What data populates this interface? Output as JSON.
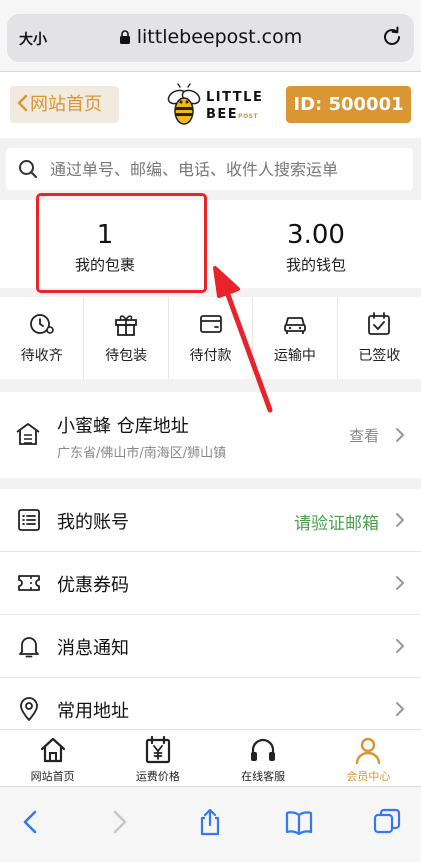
{
  "browser": {
    "text_size_label": "大小",
    "url": "littlebeepost.com"
  },
  "header": {
    "back_label": "网站首页",
    "logo_line1": "LITTLE",
    "logo_line2": "BEE",
    "logo_post": "POST",
    "id_label": "ID: 500001"
  },
  "search": {
    "placeholder": "通过单号、邮编、电话、收件人搜索运单"
  },
  "stats": [
    {
      "value": "1",
      "label": "我的包裹"
    },
    {
      "value": "3.00",
      "label": "我的钱包"
    }
  ],
  "status_items": [
    {
      "label": "待收齐",
      "icon": "clock-gear-icon"
    },
    {
      "label": "待包装",
      "icon": "gift-icon"
    },
    {
      "label": "待付款",
      "icon": "wallet-card-icon"
    },
    {
      "label": "运输中",
      "icon": "car-icon"
    },
    {
      "label": "已签收",
      "icon": "calendar-check-icon"
    }
  ],
  "warehouse": {
    "title": "小蜜蜂 仓库地址",
    "address": "广东省/佛山市/南海区/狮山镇",
    "view_label": "查看"
  },
  "menu": [
    {
      "label": "我的账号",
      "extra": "请验证邮箱",
      "icon": "list-icon"
    },
    {
      "label": "优惠券码",
      "extra": "",
      "icon": "ticket-icon"
    },
    {
      "label": "消息通知",
      "extra": "",
      "icon": "bell-icon"
    },
    {
      "label": "常用地址",
      "extra": "",
      "icon": "location-pin-icon"
    }
  ],
  "tabs": [
    {
      "label": "网站首页",
      "icon": "home-icon"
    },
    {
      "label": "运费价格",
      "icon": "calendar-yen-icon"
    },
    {
      "label": "在线客服",
      "icon": "headphones-icon"
    },
    {
      "label": "会员中心",
      "icon": "person-icon"
    }
  ],
  "colors": {
    "accent": "#d99633",
    "highlight_red": "#e8232a",
    "verify_green": "#4aa150",
    "ios_blue": "#3478f6"
  }
}
